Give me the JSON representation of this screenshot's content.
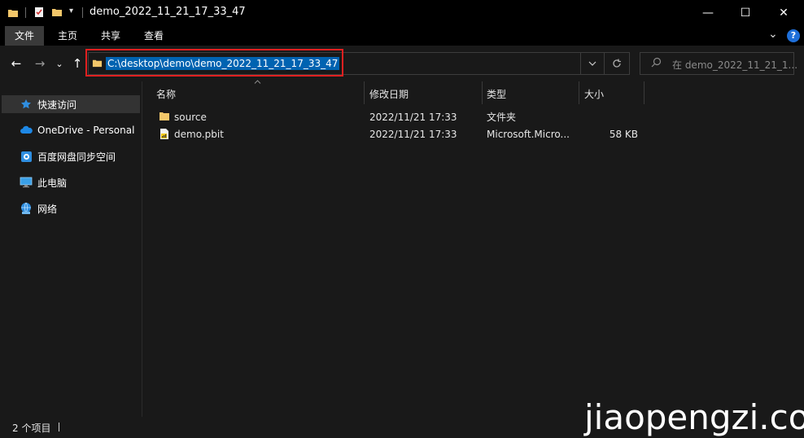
{
  "window": {
    "title": "demo_2022_11_21_17_33_47",
    "minimize_glyph": "—",
    "maximize_glyph": "☐",
    "close_glyph": "✕"
  },
  "ribbon": {
    "tabs": [
      {
        "label": "文件",
        "active": true
      },
      {
        "label": "主页"
      },
      {
        "label": "共享"
      },
      {
        "label": "查看"
      }
    ],
    "expand_glyph": "⌄",
    "help_glyph": "?"
  },
  "address": {
    "path": "C:\\desktop\\demo\\demo_2022_11_21_17_33_47",
    "highlight_color": "#e02020",
    "selection_color": "#0063b1"
  },
  "search": {
    "placeholder": "在 demo_2022_11_21_1..."
  },
  "nav": {
    "back_glyph": "←",
    "forward_glyph": "→",
    "recent_glyph": "⌄",
    "up_glyph": "↑",
    "items": [
      {
        "label": "快速访问",
        "icon": "star-icon",
        "selected": true
      },
      {
        "label": "OneDrive - Personal",
        "icon": "cloud-icon"
      },
      {
        "label": "百度网盘同步空间",
        "icon": "baidu-cloud-icon"
      },
      {
        "label": "此电脑",
        "icon": "computer-icon"
      },
      {
        "label": "网络",
        "icon": "network-icon"
      }
    ]
  },
  "columns": {
    "name": "名称",
    "date": "修改日期",
    "type": "类型",
    "size": "大小"
  },
  "files": [
    {
      "name": "source",
      "date": "2022/11/21 17:33",
      "type": "文件夹",
      "size": "",
      "icon": "folder-icon"
    },
    {
      "name": "demo.pbit",
      "date": "2022/11/21 17:33",
      "type": "Microsoft.Micro...",
      "size": "58 KB",
      "icon": "pbit-file-icon"
    }
  ],
  "status": {
    "count_text": "2 个项目"
  },
  "watermark": "jiaopengzi.com",
  "colors": {
    "background": "#191919",
    "folder": "#f3c76a"
  }
}
